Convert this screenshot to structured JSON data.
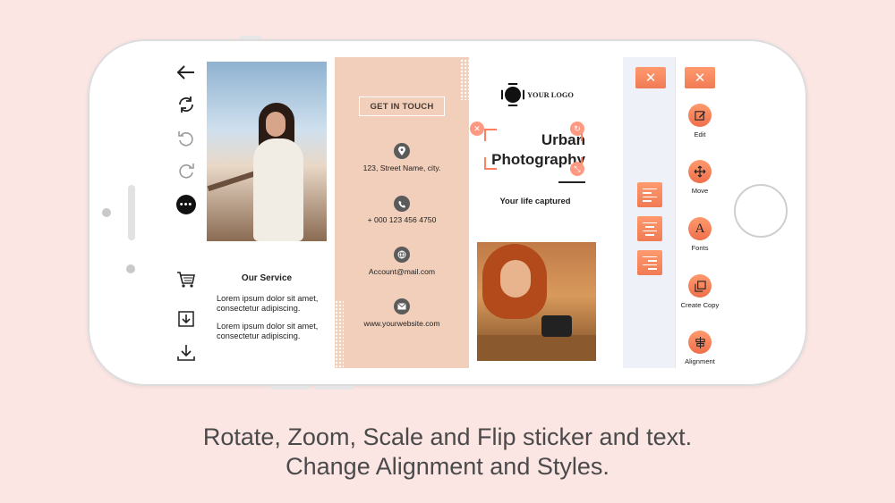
{
  "left_toolbar": {
    "back_icon": "arrow-left-icon",
    "refresh_icon": "refresh-icon",
    "undo_icon": "undo-icon",
    "redo_icon": "redo-icon",
    "more_icon": "more-icon",
    "cart_icon": "cart-icon",
    "import_icon": "import-icon",
    "download_icon": "download-icon"
  },
  "brochure": {
    "service_title": "Our Service",
    "service_p1": "Lorem ipsum dolor sit amet, consectetur adipiscing.",
    "service_p2": "Lorem ipsum dolor sit amet, consectetur adipiscing.",
    "get_in_touch": "GET IN TOUCH",
    "contacts": [
      {
        "icon": "location-icon",
        "text": "123, Street Name, city."
      },
      {
        "icon": "phone-icon",
        "text": "+ 000 123 456 4750"
      },
      {
        "icon": "globe-icon",
        "text": "Account@mail.com"
      },
      {
        "icon": "mail-icon",
        "text": "www.yourwebsite.com"
      }
    ],
    "logo_text": "YOUR LOGO",
    "headline_1": "Urban",
    "headline_2": "Photography",
    "tagline": "Your life captured"
  },
  "right_tools": {
    "close_symbol": "✕",
    "tools": [
      {
        "label": "Edit",
        "icon": "edit-icon"
      },
      {
        "label": "Move",
        "icon": "move-icon"
      },
      {
        "label": "Fonts",
        "icon": "fonts-icon"
      },
      {
        "label": "Create Copy",
        "icon": "copy-icon"
      },
      {
        "label": "Alignment",
        "icon": "alignment-icon"
      }
    ]
  },
  "caption": {
    "line1": "Rotate, Zoom, Scale and Flip sticker and text.",
    "line2": "Change Alignment and Styles."
  },
  "colors": {
    "background": "#fbe6e4",
    "accent": "#f07b55",
    "panel": "#f2cfba"
  }
}
